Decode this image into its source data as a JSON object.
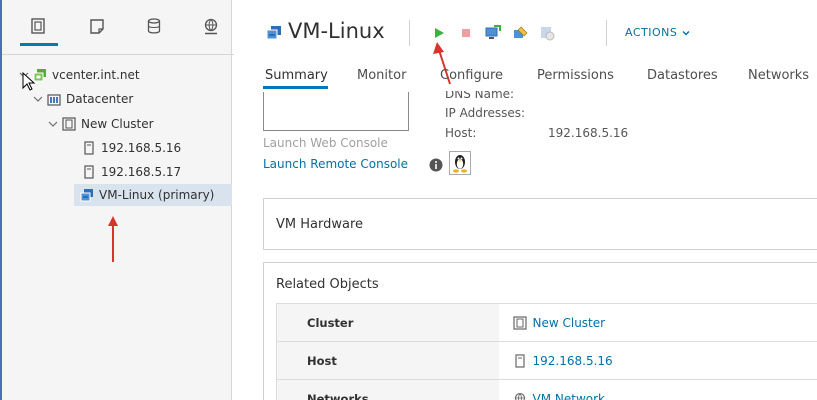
{
  "navigator": {
    "tabs": [
      {
        "name": "hosts-and-clusters",
        "active": true
      },
      {
        "name": "vms-and-templates",
        "active": false
      },
      {
        "name": "storage",
        "active": false
      },
      {
        "name": "networking",
        "active": false
      }
    ],
    "tree": [
      {
        "label": "vcenter.int.net",
        "level": 0,
        "icon": "vcenter-icon",
        "expanded": true
      },
      {
        "label": "Datacenter",
        "level": 1,
        "icon": "datacenter-icon",
        "expanded": true
      },
      {
        "label": "New Cluster",
        "level": 2,
        "icon": "cluster-icon",
        "expanded": true
      },
      {
        "label": "192.168.5.16",
        "level": 3,
        "icon": "host-icon"
      },
      {
        "label": "192.168.5.17",
        "level": 3,
        "icon": "host-icon"
      },
      {
        "label": "VM-Linux (primary)",
        "level": 3,
        "icon": "vm-icon",
        "selected": true
      }
    ]
  },
  "header": {
    "title": "VM-Linux",
    "actions_label": "ACTIONS",
    "toolbar": [
      "power-on-icon",
      "power-off-icon",
      "launch-console-icon",
      "migrate-icon",
      "snapshot-icon"
    ]
  },
  "tabs": [
    "Summary",
    "Monitor",
    "Configure",
    "Permissions",
    "Datastores",
    "Networks"
  ],
  "summary": {
    "launch_web_console": "Launch Web Console",
    "launch_remote_console": "Launch Remote Console",
    "dns_label": "DNS Name:",
    "ip_label": "IP Addresses:",
    "host_label": "Host:",
    "host_value": "192.168.5.16"
  },
  "vm_hardware": {
    "title": "VM Hardware"
  },
  "related_objects": {
    "title": "Related Objects",
    "rows": [
      {
        "key": "Cluster",
        "value": "New Cluster",
        "icon": "cluster-icon"
      },
      {
        "key": "Host",
        "value": "192.168.5.16",
        "icon": "host-icon"
      },
      {
        "key": "Networks",
        "value": "VM Network",
        "icon": "network-icon"
      }
    ]
  },
  "colors": {
    "accent": "#0079b8",
    "link": "#0072a3",
    "power_on": "#3bb33b",
    "power_off": "#e06b6b",
    "annotation": "#d9342b"
  }
}
